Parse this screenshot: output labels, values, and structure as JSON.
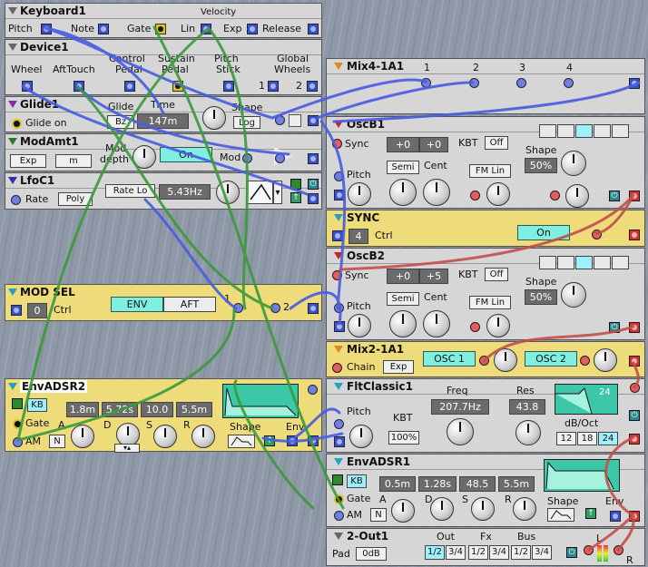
{
  "keyboard": {
    "title": "Keyboard1",
    "pitch": "Pitch",
    "note": "Note",
    "gate": "Gate",
    "velocity": "Velocity",
    "lin": "Lin",
    "exp": "Exp",
    "release": "Release"
  },
  "device": {
    "title": "Device1",
    "wheel": "Wheel",
    "afttouch": "AftTouch",
    "control": "Control",
    "control2": "Pedal",
    "sustain": "Sustain",
    "sustain2": "Pedal",
    "pitch": "Pitch",
    "pitch2": "Stick",
    "global": "Global",
    "global2": "Wheels",
    "n1": "1",
    "n2": "2"
  },
  "mix4": {
    "title": "Mix4-1A1",
    "c1": "1",
    "c2": "2",
    "c3": "3",
    "c4": "4"
  },
  "glide": {
    "title": "Glide1",
    "glide": "Glide",
    "glide_on": "Glide on",
    "time": "Time",
    "time_value": "147m",
    "shape": "Shape",
    "shape_value": "Log",
    "mode_value": "Bz"
  },
  "modamt": {
    "title": "ModAmt1",
    "exp": "Exp",
    "m": "m",
    "mod": "Mod",
    "depth": "depth",
    "on": "On",
    "mod2": "Mod"
  },
  "lfo": {
    "title": "LfoC1",
    "rate": "Rate",
    "poly": "Poly",
    "rate_lo": "Rate Lo",
    "freq": "5.43Hz"
  },
  "oscb1": {
    "title": "OscB1",
    "sync": "Sync",
    "semi_val": "+0",
    "cent_val": "+0",
    "kbt": "KBT",
    "kbt_val": "Off",
    "pitch": "Pitch",
    "semi": "Semi",
    "cent": "Cent",
    "fm": "FM Lin",
    "shape": "Shape",
    "shape_val": "50%"
  },
  "sync": {
    "title": "SYNC",
    "val": "4",
    "ctrl": "Ctrl",
    "on": "On"
  },
  "oscb2": {
    "title": "OscB2",
    "sync": "Sync",
    "semi_val": "+0",
    "cent_val": "+5",
    "kbt": "KBT",
    "kbt_val": "Off",
    "pitch": "Pitch",
    "semi": "Semi",
    "cent": "Cent",
    "fm": "FM Lin",
    "shape": "Shape",
    "shape_val": "50%"
  },
  "modsel": {
    "title": "MOD SEL",
    "val": "0",
    "ctrl": "Ctrl",
    "env": "ENV",
    "aft": "AFT",
    "n1": "1",
    "n2": "2"
  },
  "mix2": {
    "title": "Mix2-1A1",
    "chain": "Chain",
    "exp": "Exp",
    "osc1": "OSC 1",
    "osc2": "OSC 2"
  },
  "envadsr2": {
    "title": "EnvADSR2",
    "kb": "KB",
    "gate": "Gate",
    "am": "AM",
    "n": "N",
    "a": "1.8m",
    "d": "5.72s",
    "s": "10.0",
    "r": "5.5m",
    "la": "A",
    "ld": "D",
    "ls": "S",
    "lr": "R",
    "shape": "Shape",
    "env": "Env"
  },
  "flt": {
    "title": "FltClassic1",
    "pitch": "Pitch",
    "freq": "Freq",
    "freq_val": "207.7Hz",
    "res": "Res",
    "res_val": "43.8",
    "kbt": "KBT",
    "kbt_val": "100%",
    "db": "dB/Oct",
    "s12": "12",
    "s18": "18",
    "s24": "24",
    "g24": "24"
  },
  "envadsr1": {
    "title": "EnvADSR1",
    "kb": "KB",
    "gate": "Gate",
    "am": "AM",
    "n": "N",
    "a": "0.5m",
    "d": "1.28s",
    "s": "48.5",
    "r": "5.5m",
    "la": "A",
    "ld": "D",
    "ls": "S",
    "lr": "R",
    "shape": "Shape",
    "env": "Env"
  },
  "out": {
    "title": "2-Out1",
    "pad": "Pad",
    "pad_val": "0dB",
    "out": "Out",
    "fx": "Fx",
    "bus": "Bus",
    "o12": "1/2",
    "o34": "3/4",
    "f12": "1/2",
    "f34": "3/4",
    "b12": "1/2",
    "b34": "3/4",
    "l": "L",
    "r": "R"
  }
}
